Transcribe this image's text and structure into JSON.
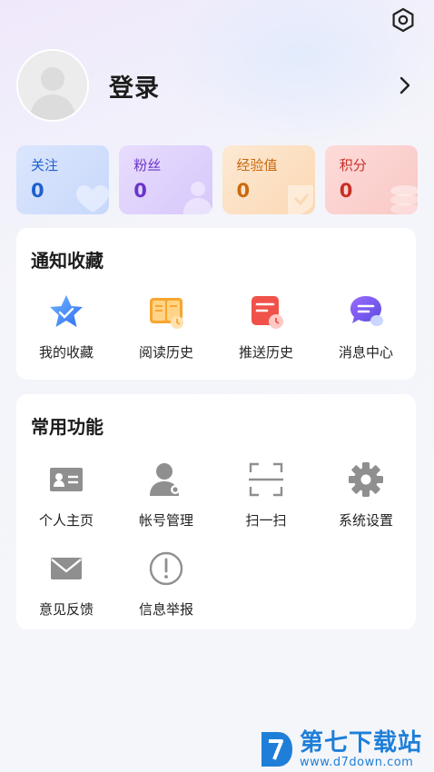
{
  "profile": {
    "login_label": "登录"
  },
  "stats": [
    {
      "label": "关注",
      "value": "0"
    },
    {
      "label": "粉丝",
      "value": "0"
    },
    {
      "label": "经验值",
      "value": "0"
    },
    {
      "label": "积分",
      "value": "0"
    }
  ],
  "notify_section": {
    "title": "通知收藏",
    "items": [
      {
        "label": "我的收藏",
        "icon": "star-icon"
      },
      {
        "label": "阅读历史",
        "icon": "book-history-icon"
      },
      {
        "label": "推送历史",
        "icon": "push-history-icon"
      },
      {
        "label": "消息中心",
        "icon": "message-icon"
      }
    ]
  },
  "common_section": {
    "title": "常用功能",
    "items": [
      {
        "label": "个人主页",
        "icon": "id-card-icon"
      },
      {
        "label": "帐号管理",
        "icon": "user-settings-icon"
      },
      {
        "label": "扫一扫",
        "icon": "scan-icon"
      },
      {
        "label": "系统设置",
        "icon": "gear-icon"
      },
      {
        "label": "意见反馈",
        "icon": "mail-icon"
      },
      {
        "label": "信息举报",
        "icon": "alert-icon"
      }
    ]
  },
  "watermark": {
    "title": "第七下载站",
    "url": "www.d7down.com"
  },
  "colors": {
    "accent_blue": "#1f5fcf",
    "accent_purple": "#6a34c9",
    "accent_orange": "#c86a10",
    "accent_red": "#c63128"
  }
}
